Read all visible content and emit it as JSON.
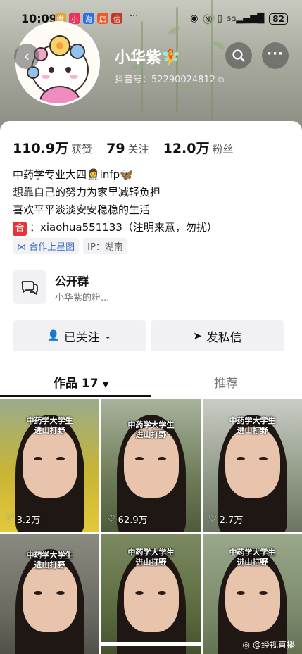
{
  "status_bar": {
    "time": "10:09",
    "battery": "82",
    "network": "5G",
    "more": "···"
  },
  "profile": {
    "name": "小华紫",
    "name_emoji": "🧚",
    "douyin_id": "抖音号：52290024812",
    "stats": [
      {
        "num": "110.9万",
        "label": "获赞"
      },
      {
        "num": "79",
        "label": "关注"
      },
      {
        "num": "12.0万",
        "label": "粉丝"
      }
    ],
    "bio": [
      "中药学专业大四👩‍⚕️infp🦋",
      "想靠自己的努力为家里减轻负担",
      "喜欢平平淡淡安安稳稳的生活"
    ],
    "contact_tag": "合",
    "contact": "：xiaohua551133（注明来意，勿扰）",
    "tags": {
      "star": "合作上星图",
      "ip": "IP：湖南"
    }
  },
  "group": {
    "title": "公开群",
    "subtitle": "小华紫的粉..."
  },
  "buttons": {
    "follow": "已关注",
    "message": "发私信"
  },
  "tabs": {
    "works": "作品 17",
    "recommend": "推荐"
  },
  "videos": [
    {
      "caption1": "中药学大学生",
      "caption2": "进山打野",
      "likes": "3.2万",
      "bg": "#c8b535"
    },
    {
      "caption1": "中药学大学生",
      "caption2": "进山打野",
      "likes": "62.9万",
      "bg": "#6d7c57"
    },
    {
      "caption1": "中药学大学生",
      "caption2": "进山打野",
      "likes": "2.7万",
      "bg": "#8f9a86"
    },
    {
      "caption1": "中药学大学生",
      "caption2": "进山打野",
      "likes": "",
      "bg": "#6a6a60"
    },
    {
      "caption1": "中药学大学生",
      "caption2": "进山打野",
      "likes": "",
      "bg": "#5a6a3e"
    },
    {
      "caption1": "中药学大学生",
      "caption2": "进山打野",
      "likes": "",
      "bg": "#7a8a6a"
    }
  ],
  "watermark": "@经视直播"
}
